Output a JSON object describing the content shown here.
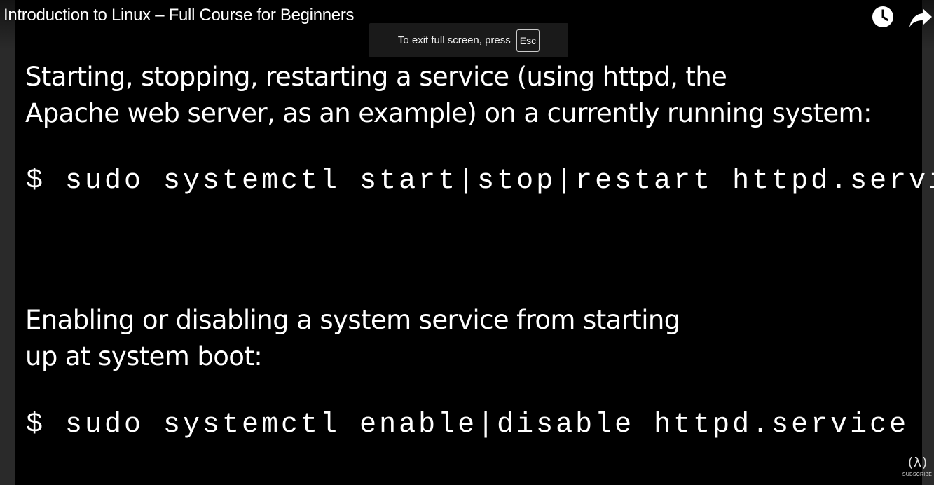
{
  "video": {
    "title": "Introduction to Linux – Full Course for Beginners"
  },
  "toolbar": {
    "watch_later_icon": "clock-icon",
    "share_icon": "share-arrow-icon"
  },
  "fullscreen_toast": {
    "text": "To exit full screen, press",
    "key": "Esc"
  },
  "slide": {
    "heading1_line1": "Starting, stopping, restarting a service (using httpd, the",
    "heading1_line2": "Apache web server, as an example) on a currently running system:",
    "command1": "$ sudo systemctl start|stop|restart httpd.service",
    "heading2_line1": "Enabling or disabling a system service from starting",
    "heading2_line2": "up at system boot:",
    "command2": "$ sudo systemctl enable|disable httpd.service"
  },
  "branding": {
    "mark": "(λ)",
    "label": "SUBSCRIBE"
  }
}
